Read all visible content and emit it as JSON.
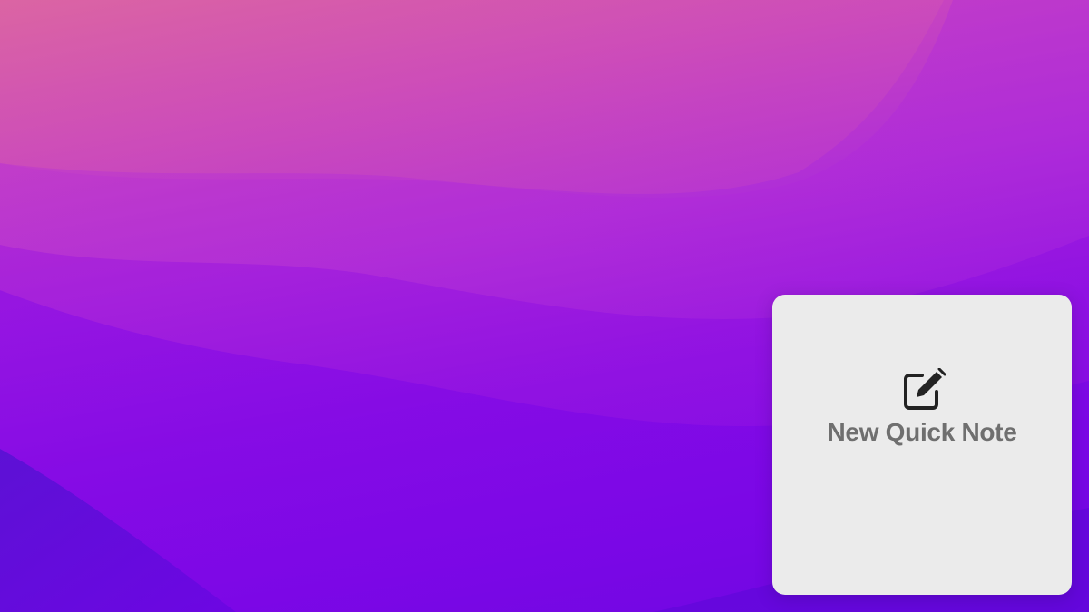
{
  "desktop": {
    "wallpaper_colors": {
      "top_left": "#d65fa6",
      "middle": "#a61ee0",
      "bottom": "#6a08e0"
    }
  },
  "quick_note": {
    "label": "New Quick Note",
    "icon": "compose-note-icon",
    "card_color": "#ebebeb",
    "text_color": "#6f6f6f"
  }
}
